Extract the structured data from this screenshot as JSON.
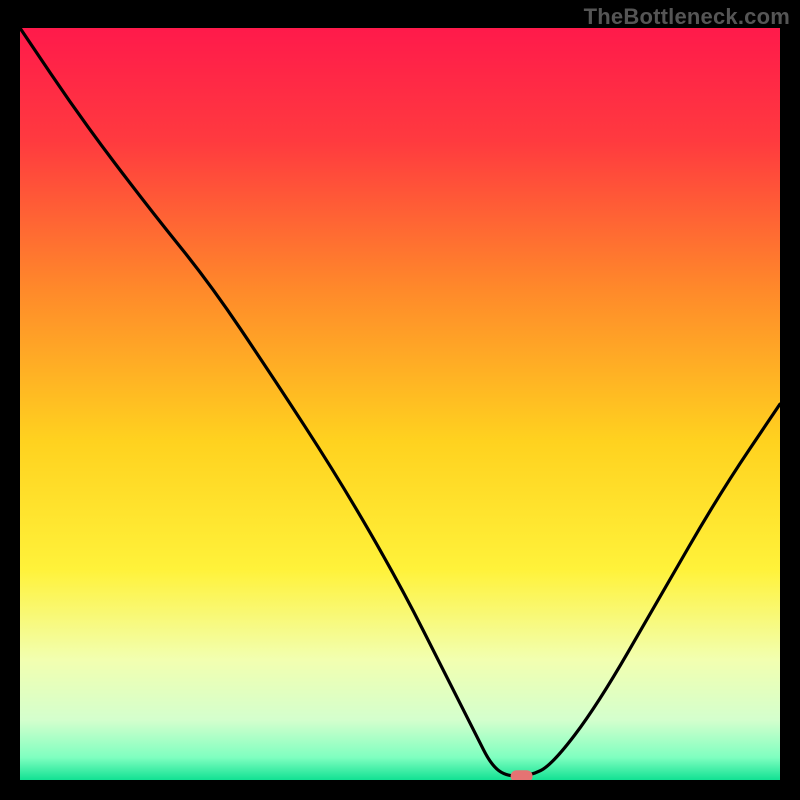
{
  "watermark": "TheBottleneck.com",
  "chart_data": {
    "type": "line",
    "title": "",
    "xlabel": "",
    "ylabel": "",
    "xlim": [
      0,
      100
    ],
    "ylim": [
      0,
      100
    ],
    "background_gradient": {
      "stops": [
        {
          "offset": 0.0,
          "color": "#ff1a4b"
        },
        {
          "offset": 0.15,
          "color": "#ff3a3f"
        },
        {
          "offset": 0.35,
          "color": "#ff8a2a"
        },
        {
          "offset": 0.55,
          "color": "#ffd21f"
        },
        {
          "offset": 0.72,
          "color": "#fff23a"
        },
        {
          "offset": 0.84,
          "color": "#f2ffb0"
        },
        {
          "offset": 0.92,
          "color": "#d4ffcd"
        },
        {
          "offset": 0.97,
          "color": "#7fffc0"
        },
        {
          "offset": 1.0,
          "color": "#12e193"
        }
      ]
    },
    "series": [
      {
        "name": "bottleneck-curve",
        "color": "#000000",
        "points": [
          {
            "x": 0,
            "y": 100
          },
          {
            "x": 8,
            "y": 88
          },
          {
            "x": 17,
            "y": 76
          },
          {
            "x": 25,
            "y": 66
          },
          {
            "x": 33,
            "y": 54
          },
          {
            "x": 42,
            "y": 40
          },
          {
            "x": 50,
            "y": 26
          },
          {
            "x": 56,
            "y": 14
          },
          {
            "x": 60,
            "y": 6
          },
          {
            "x": 62,
            "y": 2
          },
          {
            "x": 64,
            "y": 0.5
          },
          {
            "x": 67,
            "y": 0.5
          },
          {
            "x": 70,
            "y": 2
          },
          {
            "x": 76,
            "y": 10
          },
          {
            "x": 84,
            "y": 24
          },
          {
            "x": 92,
            "y": 38
          },
          {
            "x": 100,
            "y": 50
          }
        ]
      }
    ],
    "marker": {
      "x": 66,
      "y": 0.5,
      "color": "#e57373"
    }
  }
}
